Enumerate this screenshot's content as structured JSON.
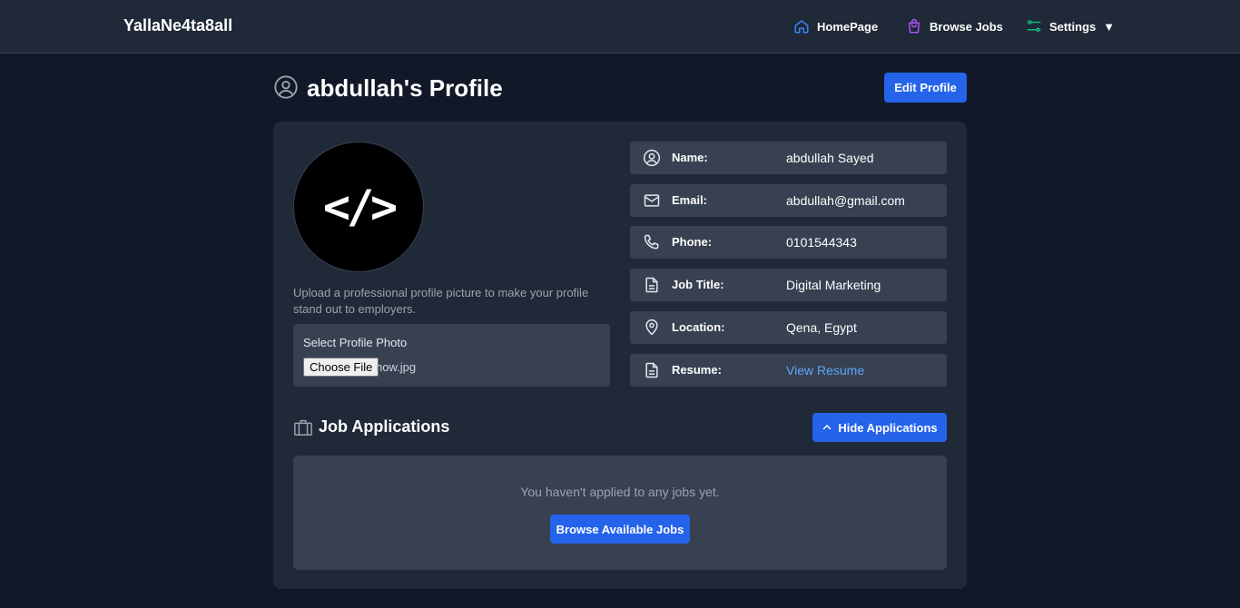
{
  "navbar": {
    "brand": "YallaNe4ta8all",
    "items": [
      {
        "label": "HomePage",
        "icon": "home-icon",
        "icon_color": "#3b82f6"
      },
      {
        "label": "Browse Jobs",
        "icon": "shopping-bag-icon",
        "icon_color": "#a855f7"
      },
      {
        "label": "Settings",
        "icon": "sliders-icon",
        "icon_color": "#10b981"
      }
    ],
    "settings_caret": "▼"
  },
  "header": {
    "title": "abdullah's Profile",
    "edit_button": "Edit Profile"
  },
  "photo": {
    "avatar_glyph": "</>",
    "hint": "Upload a professional profile picture to make your profile stand out to employers.",
    "upload_label": "Select Profile Photo",
    "choose_file": "Choose File",
    "file_name": "now.jpg"
  },
  "info": [
    {
      "label": "Name:",
      "value": "abdullah Sayed",
      "icon": "user-circle-icon"
    },
    {
      "label": "Email:",
      "value": "abdullah@gmail.com",
      "icon": "mail-icon"
    },
    {
      "label": "Phone:",
      "value": "0101544343",
      "icon": "phone-icon"
    },
    {
      "label": "Job Title:",
      "value": "Digital Marketing",
      "icon": "document-icon"
    },
    {
      "label": "Location:",
      "value": "Qena, Egypt",
      "icon": "map-pin-icon"
    },
    {
      "label": "Resume:",
      "value": "View Resume",
      "icon": "document-icon"
    }
  ],
  "applications": {
    "title": "Job Applications",
    "toggle_button": "Hide Applications",
    "empty_message": "You haven't applied to any jobs yet.",
    "browse_button": "Browse Available Jobs"
  },
  "colors": {
    "page_bg": "#111827",
    "card_bg": "#1f2937",
    "row_bg": "#374151",
    "accent": "#2563eb",
    "link": "#60a5fa"
  }
}
